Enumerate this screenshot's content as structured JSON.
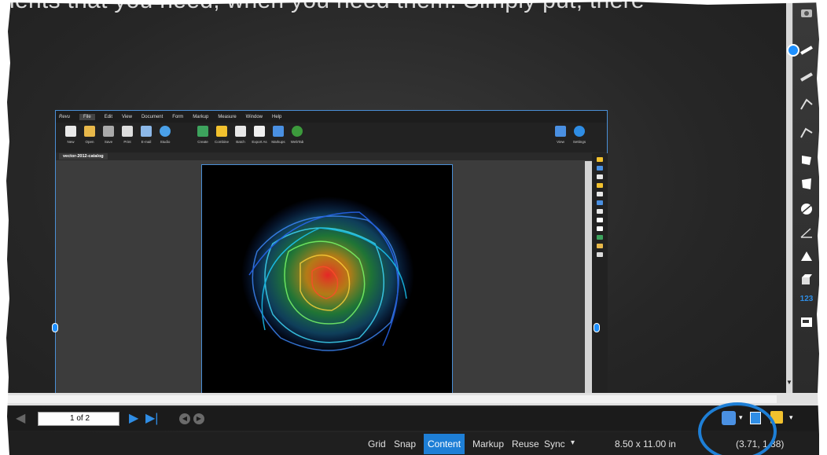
{
  "background_text": "ients that you need, when you need them. Simply put, there",
  "app": {
    "menu": [
      "File",
      "Edit",
      "View",
      "Document",
      "Form",
      "Markup",
      "Measure",
      "Window",
      "Help"
    ],
    "logo": "Revu",
    "ribbon_left": [
      "New",
      "Open",
      "Save",
      "Print",
      "E-mail",
      "Studio"
    ],
    "ribbon_mid": [
      "Create",
      "Combine",
      "Batch",
      "Export As",
      "Markups",
      "WebTab"
    ],
    "ribbon_right": [
      "View",
      "Settings"
    ],
    "document_tab": "vector-2012-catalog"
  },
  "navigation": {
    "page_indicator": "1 of 2"
  },
  "status_bar": {
    "items": [
      "Grid",
      "Snap",
      "Content",
      "Markup",
      "Reuse",
      "Sync"
    ],
    "active_item": "Content",
    "sync_dropdown": "▾",
    "page_size": "8.50 x 11.00 in",
    "coordinates": "(3.71, 1.38)"
  },
  "right_tools": {
    "counter_label": "123"
  },
  "colors": {
    "accent": "#1e7fd6",
    "background": "#262626"
  }
}
